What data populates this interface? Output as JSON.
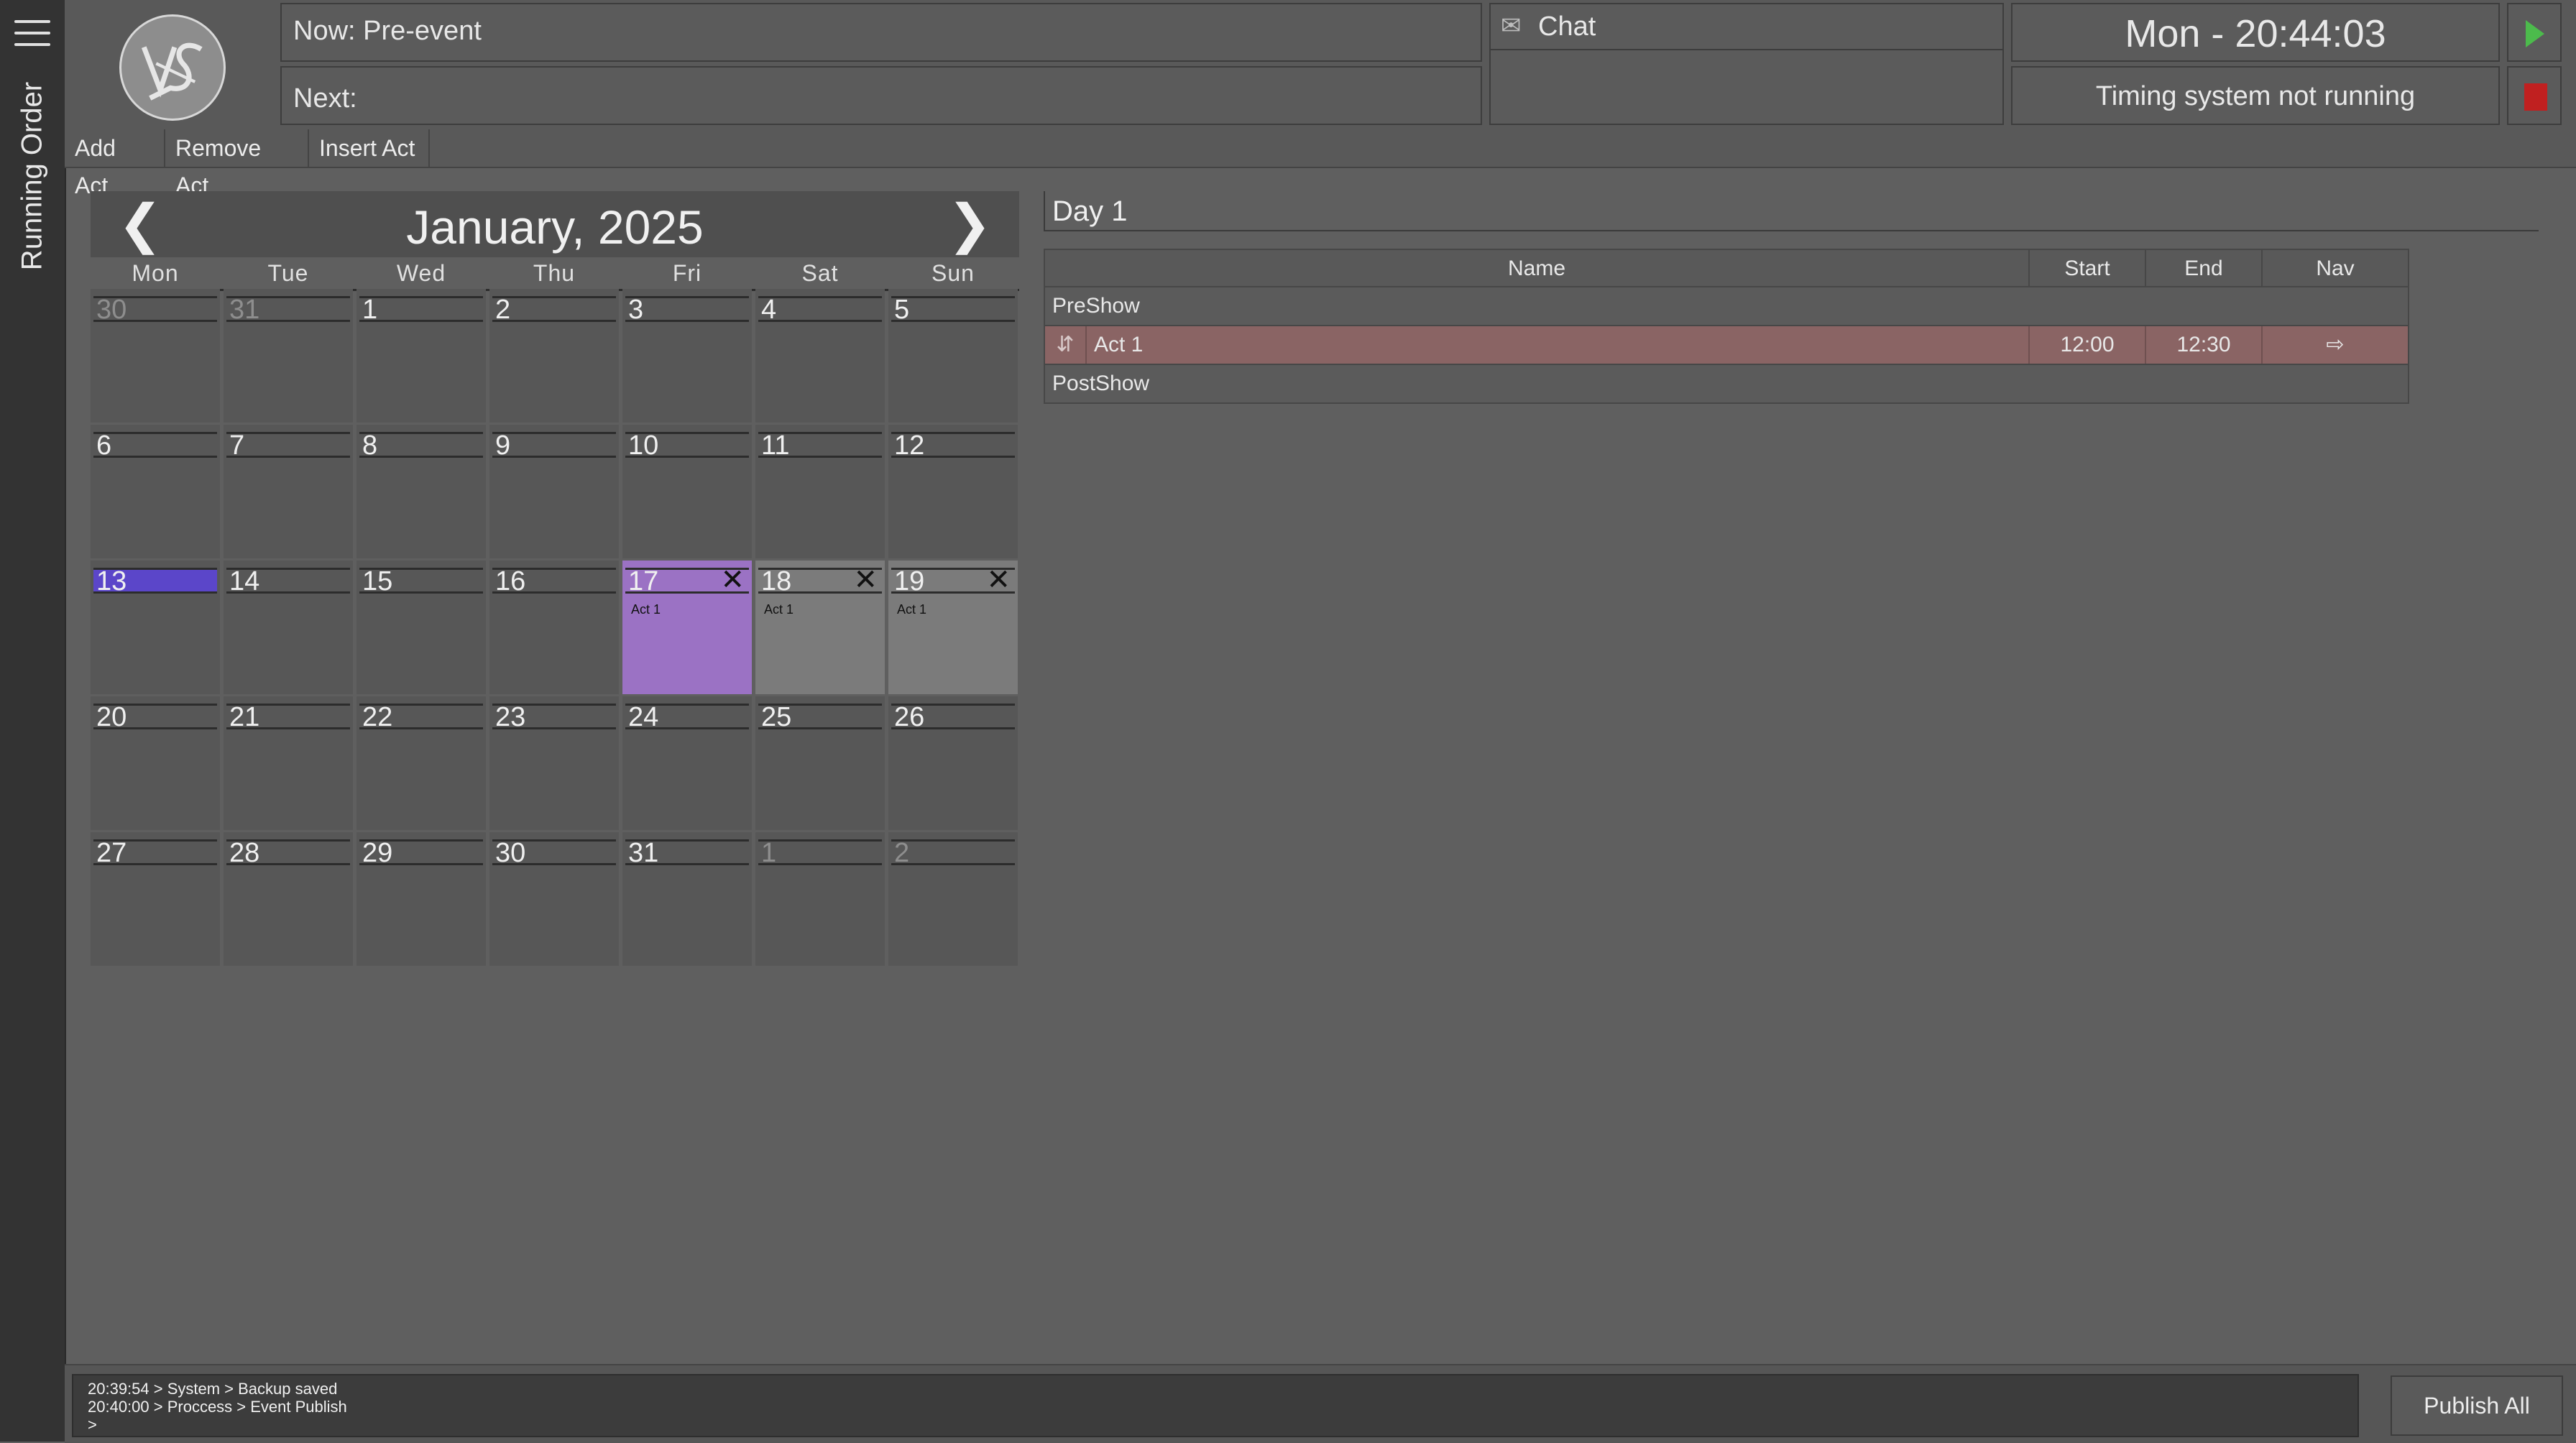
{
  "sidebar": {
    "label": "Running Order"
  },
  "header": {
    "now": "Now: Pre-event",
    "next": "Next:",
    "chat_title": "Chat",
    "clock": "Mon - 20:44:03",
    "timing_status": "Timing system not running"
  },
  "toolbar": {
    "add": "Add Act",
    "remove": "Remove Act",
    "insert": "Insert Act"
  },
  "calendar": {
    "prev": "❮",
    "next": "❯",
    "title": "January, 2025",
    "weekdays": [
      "Mon",
      "Tue",
      "Wed",
      "Thu",
      "Fri",
      "Sat",
      "Sun"
    ],
    "close_glyph": "✕",
    "weeks": [
      [
        {
          "n": "30",
          "other": true
        },
        {
          "n": "31",
          "other": true
        },
        {
          "n": "1"
        },
        {
          "n": "2"
        },
        {
          "n": "3"
        },
        {
          "n": "4"
        },
        {
          "n": "5"
        }
      ],
      [
        {
          "n": "6"
        },
        {
          "n": "7"
        },
        {
          "n": "8"
        },
        {
          "n": "9"
        },
        {
          "n": "10"
        },
        {
          "n": "11"
        },
        {
          "n": "12"
        }
      ],
      [
        {
          "n": "13",
          "state": "today"
        },
        {
          "n": "14"
        },
        {
          "n": "15"
        },
        {
          "n": "16"
        },
        {
          "n": "17",
          "state": "selected",
          "act": "Act 1",
          "removable": true
        },
        {
          "n": "18",
          "state": "has-events",
          "act": "Act 1",
          "removable": true
        },
        {
          "n": "19",
          "state": "has-events",
          "act": "Act 1",
          "removable": true
        }
      ],
      [
        {
          "n": "20"
        },
        {
          "n": "21"
        },
        {
          "n": "22"
        },
        {
          "n": "23"
        },
        {
          "n": "24"
        },
        {
          "n": "25"
        },
        {
          "n": "26"
        }
      ],
      [
        {
          "n": "27"
        },
        {
          "n": "28"
        },
        {
          "n": "29"
        },
        {
          "n": "30"
        },
        {
          "n": "31"
        },
        {
          "n": "1",
          "other": true
        },
        {
          "n": "2",
          "other": true
        }
      ]
    ]
  },
  "day_panel": {
    "title": "Day 1",
    "columns": {
      "name": "Name",
      "start": "Start",
      "end": "End",
      "nav": "Nav"
    },
    "preshow": "PreShow",
    "act": {
      "handle": "⇵",
      "name": "Act 1",
      "start": "12:00",
      "end": "12:30",
      "nav": "⇨"
    },
    "postshow": "PostShow"
  },
  "footer": {
    "log_lines": [
      "20:39:54 > System > Backup saved",
      "20:40:00 > Proccess > Event Publish",
      ">"
    ],
    "publish": "Publish All"
  },
  "colors": {
    "today": "#5b46c9",
    "selected": "#9b72c4",
    "act_row": "#8a6464",
    "play": "#4cbb4c",
    "stop": "#c02020"
  },
  "icons": {
    "menu": "hamburger-icon",
    "logo": "logo-icon",
    "chat": "envelope-icon",
    "play": "play-icon",
    "stop": "stop-icon"
  }
}
